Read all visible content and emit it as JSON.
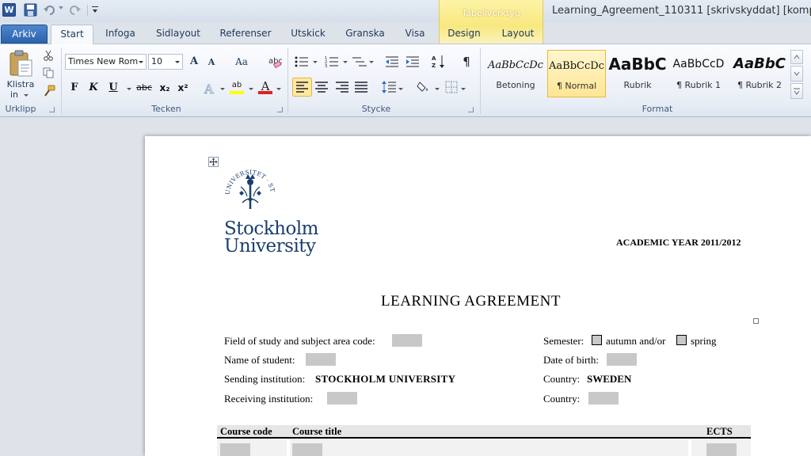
{
  "window": {
    "title": "Learning_Agreement_110311 [skrivskyddat] [kompati",
    "contextual_group": "Tabellverktyg",
    "app_icon_letter": "W"
  },
  "tabs": [
    "Arkiv",
    "Start",
    "Infoga",
    "Sidlayout",
    "Referenser",
    "Utskick",
    "Granska",
    "Visa",
    "Design",
    "Layout"
  ],
  "ribbon": {
    "clipboard": {
      "paste_label": "Klistra",
      "paste_label2": "in",
      "group_label": "Urklipp"
    },
    "font": {
      "font_name": "Times New Rom",
      "font_size": "10",
      "group_label": "Tecken",
      "bold": "F",
      "italic": "K",
      "underline": "U",
      "strike": "abc",
      "subscript": "x₂",
      "superscript": "x²",
      "change_case": "Aa",
      "grow": "A",
      "shrink": "A",
      "highlight_glyph": "ab",
      "font_color_glyph": "A",
      "highlight_color": "#ffff00",
      "font_color": "#e02020"
    },
    "paragraph": {
      "group_label": "Stycke",
      "pilcrow": "¶"
    },
    "styles": {
      "group_label": "Format",
      "items": [
        {
          "preview": "AaBbCcDc",
          "name": "Betoning"
        },
        {
          "preview": "AaBbCcDc",
          "name": "¶ Normal",
          "selected": true
        },
        {
          "preview": "AaBbC",
          "name": "Rubrik"
        },
        {
          "preview": "AaBbCcD",
          "name": "¶ Rubrik 1"
        },
        {
          "preview": "AaBbC",
          "name": "¶ Rubrik 2"
        }
      ]
    }
  },
  "document": {
    "university_line1": "Stockholm",
    "university_line2": "University",
    "seal_text": "UNIVERSITET · STOCKHOLMS ·",
    "academic_year": "ACADEMIC YEAR 2011/2012",
    "heading": "LEARNING  AGREEMENT",
    "fields": {
      "field_of_study": "Field  of study and subject area code:",
      "name_of_student": "Name of student:",
      "sending_label": "Sending institution:",
      "sending_value": "STOCKHOLM  UNIVERSITY",
      "receiving_label": "Receiving institution:",
      "semester_label": "Semester:",
      "autumn": "autumn and/or",
      "spring": "spring",
      "dob_label": "Date of birth:",
      "country1_label": "Country:",
      "country1_value": "SWEDEN",
      "country2_label": "Country:"
    },
    "table_headers": [
      "Course code",
      "Course title",
      "ECTS"
    ]
  },
  "colors": {
    "file_tab": "#2a62ad",
    "university_blue": "#1b3e6f",
    "field_shading": "#c8c8c8"
  }
}
